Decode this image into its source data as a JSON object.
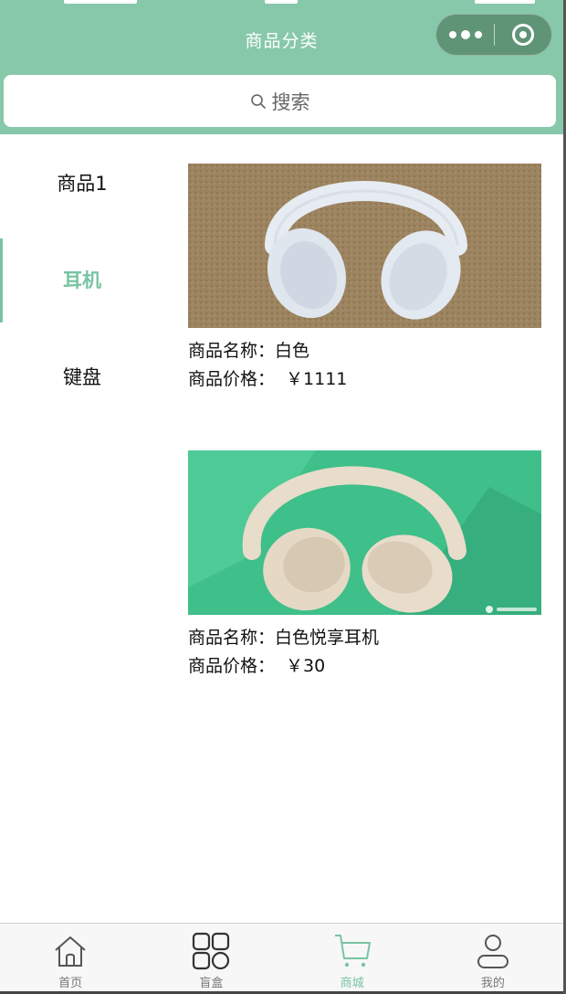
{
  "header": {
    "title": "商品分类",
    "capsule_more_icon": "more-dots-icon",
    "capsule_close_icon": "target-icon"
  },
  "search": {
    "placeholder": "搜索",
    "icon": "search-icon"
  },
  "categories": [
    {
      "label": "商品1",
      "active": false
    },
    {
      "label": "耳机",
      "active": true
    },
    {
      "label": "键盘",
      "active": false
    }
  ],
  "products": [
    {
      "name_label": "商品名称：",
      "name": "白色",
      "price_label": "商品价格：",
      "price": "￥1111"
    },
    {
      "name_label": "商品名称：",
      "name": "白色悦享耳机",
      "price_label": "商品价格：",
      "price": "￥30"
    }
  ],
  "tabbar": [
    {
      "label": "首页",
      "icon": "home-icon",
      "active": false
    },
    {
      "label": "盲盒",
      "icon": "grid-icon",
      "active": false
    },
    {
      "label": "商城",
      "icon": "cart-icon",
      "active": true
    },
    {
      "label": "我的",
      "icon": "user-icon",
      "active": false
    }
  ],
  "colors": {
    "header_bg": "#87c8aa",
    "accent": "#78c4a2",
    "tab_inactive": "#777777"
  }
}
